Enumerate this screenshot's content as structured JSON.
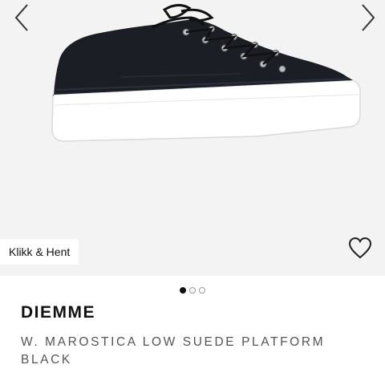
{
  "gallery": {
    "prev_icon": "chevron-left-icon",
    "next_icon": "chevron-right-icon",
    "image_subject": "sneaker",
    "badge_label": "Klikk & Hent",
    "wishlist_icon": "heart-outline-icon",
    "pager": {
      "total": 3,
      "active_index": 0
    }
  },
  "product": {
    "brand": "DIEMME",
    "name": "W. MAROSTICA LOW SUEDE PLATFORM BLACK"
  },
  "colors": {
    "gallery_background": "#f3f3f3",
    "shoe_upper": "#1c1e26",
    "sole": "#ffffff",
    "text_primary": "#111111",
    "text_secondary": "#555555"
  }
}
